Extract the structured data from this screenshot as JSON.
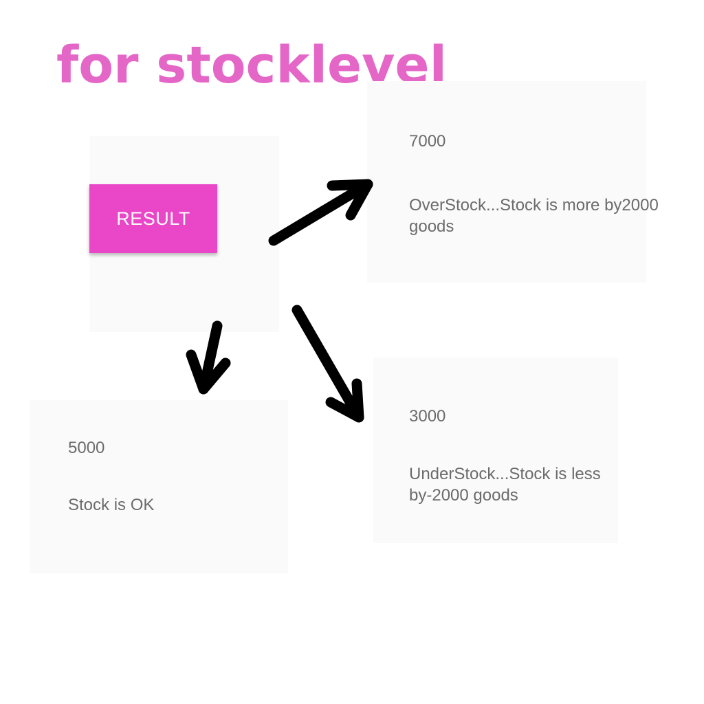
{
  "caption": {
    "text": "for stocklevel",
    "color": "#e466c6"
  },
  "result_button": {
    "label": "RESULT",
    "color": "#ea47c8"
  },
  "text_color": "#6b6b6b",
  "outputs": {
    "overstock": {
      "value": "7000",
      "message_line1": "OverStock...Stock is more by2000",
      "message_line2": "goods"
    },
    "ok": {
      "value": "5000",
      "message": "Stock is OK"
    },
    "understock": {
      "value": "3000",
      "message_line1": "UnderStock...Stock is less",
      "message_line2": "by-2000 goods"
    }
  },
  "arrow_color": "#000000"
}
